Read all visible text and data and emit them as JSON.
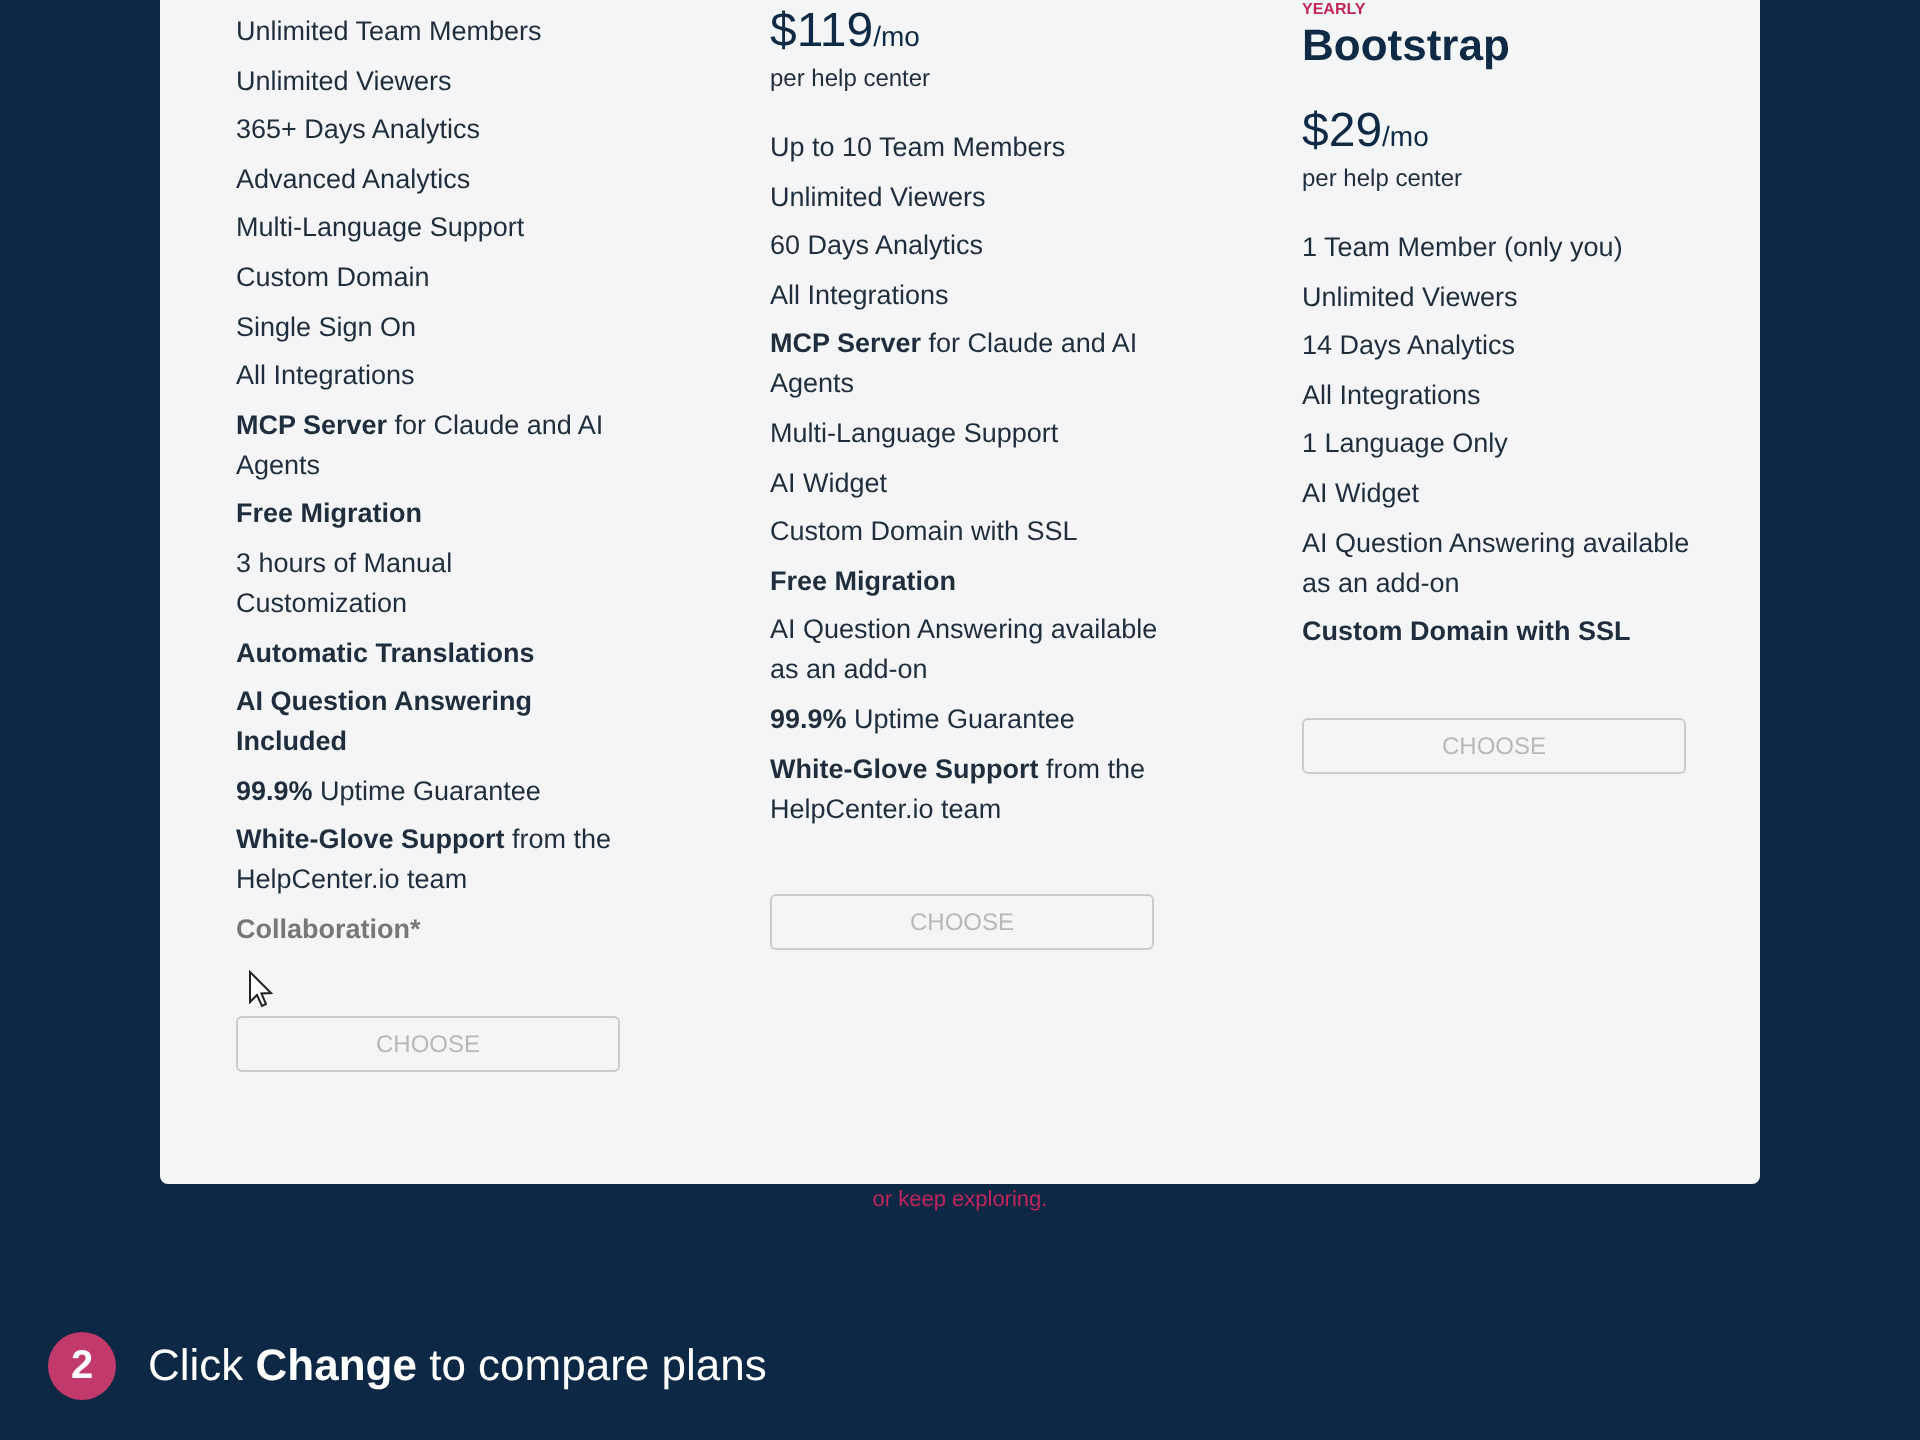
{
  "plans": [
    {
      "features": [
        {
          "text": "Unlimited Team Members",
          "kind": "plain"
        },
        {
          "text": "Unlimited Viewers",
          "kind": "plain"
        },
        {
          "text": "365+ Days Analytics",
          "kind": "plain"
        },
        {
          "text": "Advanced Analytics",
          "kind": "plain"
        },
        {
          "text": "Multi-Language Support",
          "kind": "plain"
        },
        {
          "text": "Custom Domain",
          "kind": "plain"
        },
        {
          "text": "Single Sign On",
          "kind": "plain"
        },
        {
          "text": "All Integrations",
          "kind": "plain"
        },
        {
          "text": "**MCP Server** for Claude and AI Agents",
          "kind": "plain"
        },
        {
          "text": "Free Migration",
          "kind": "bold"
        },
        {
          "text": "3 hours of Manual Customization",
          "kind": "plain"
        },
        {
          "text": "Automatic Translations",
          "kind": "bold"
        },
        {
          "text": "AI Question Answering Included",
          "kind": "bold"
        },
        {
          "text": "**99.9%** Uptime Guarantee",
          "kind": "plain"
        },
        {
          "text": "**White-Glove Support** from the HelpCenter.io team",
          "kind": "plain"
        },
        {
          "text": "Collaboration*",
          "kind": "muted"
        }
      ],
      "button": "CHOOSE"
    },
    {
      "price": "$119",
      "price_unit": "/mo",
      "price_note": "per help center",
      "features": [
        {
          "text": "Up to 10 Team Members",
          "kind": "plain"
        },
        {
          "text": "Unlimited Viewers",
          "kind": "plain"
        },
        {
          "text": "60 Days Analytics",
          "kind": "plain"
        },
        {
          "text": "All Integrations",
          "kind": "plain"
        },
        {
          "text": "**MCP Server** for Claude and AI Agents",
          "kind": "plain"
        },
        {
          "text": "Multi-Language Support",
          "kind": "plain"
        },
        {
          "text": "AI Widget",
          "kind": "plain"
        },
        {
          "text": "Custom Domain with SSL",
          "kind": "plain"
        },
        {
          "text": "Free Migration",
          "kind": "bold"
        },
        {
          "text": "AI Question Answering available as an add-on",
          "kind": "plain"
        },
        {
          "text": "**99.9%** Uptime Guarantee",
          "kind": "plain"
        },
        {
          "text": "**White-Glove Support** from the HelpCenter.io team",
          "kind": "plain"
        }
      ],
      "button": "CHOOSE"
    },
    {
      "label": "YEARLY",
      "name": "Bootstrap",
      "price": "$29",
      "price_unit": "/mo",
      "price_note": "per help center",
      "features": [
        {
          "text": "1 Team Member (only you)",
          "kind": "plain"
        },
        {
          "text": "Unlimited Viewers",
          "kind": "plain"
        },
        {
          "text": "14 Days Analytics",
          "kind": "plain"
        },
        {
          "text": "All Integrations",
          "kind": "plain"
        },
        {
          "text": "1 Language Only",
          "kind": "plain"
        },
        {
          "text": "AI Widget",
          "kind": "plain"
        },
        {
          "text": "AI Question Answering available as an add-on",
          "kind": "plain"
        },
        {
          "text": "Custom Domain with SSL",
          "kind": "bold"
        }
      ],
      "button": "CHOOSE"
    }
  ],
  "footer_link": "or keep exploring.",
  "step": {
    "number": "2",
    "text": "Click **Change** to compare plans"
  }
}
